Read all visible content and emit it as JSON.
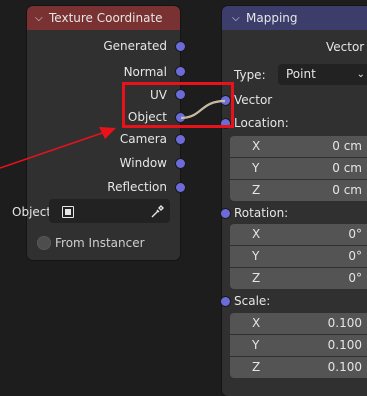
{
  "texture_coordinate": {
    "title": "Texture Coordinate",
    "outputs": [
      "Generated",
      "Normal",
      "UV",
      "Object",
      "Camera",
      "Window",
      "Reflection"
    ],
    "object_label": "Object:",
    "from_instancer": "From Instancer"
  },
  "mapping": {
    "title": "Mapping",
    "vector_output": "Vector",
    "type_label": "Type:",
    "type_value": "Point",
    "vector_input": "Vector",
    "location": {
      "label": "Location:",
      "x": "0 cm",
      "y": "0 cm",
      "z": "0 cm"
    },
    "rotation": {
      "label": "Rotation:",
      "x": "0°",
      "y": "0°",
      "z": "0°"
    },
    "scale": {
      "label": "Scale:",
      "x": "0.100",
      "y": "0.100",
      "z": "0.100"
    },
    "axes": [
      "X",
      "Y",
      "Z"
    ]
  },
  "colors": {
    "tc_header": "#7a3131",
    "map_header": "#3c3d6b",
    "socket": "#6b6bd9",
    "highlight": "#e8121a"
  }
}
